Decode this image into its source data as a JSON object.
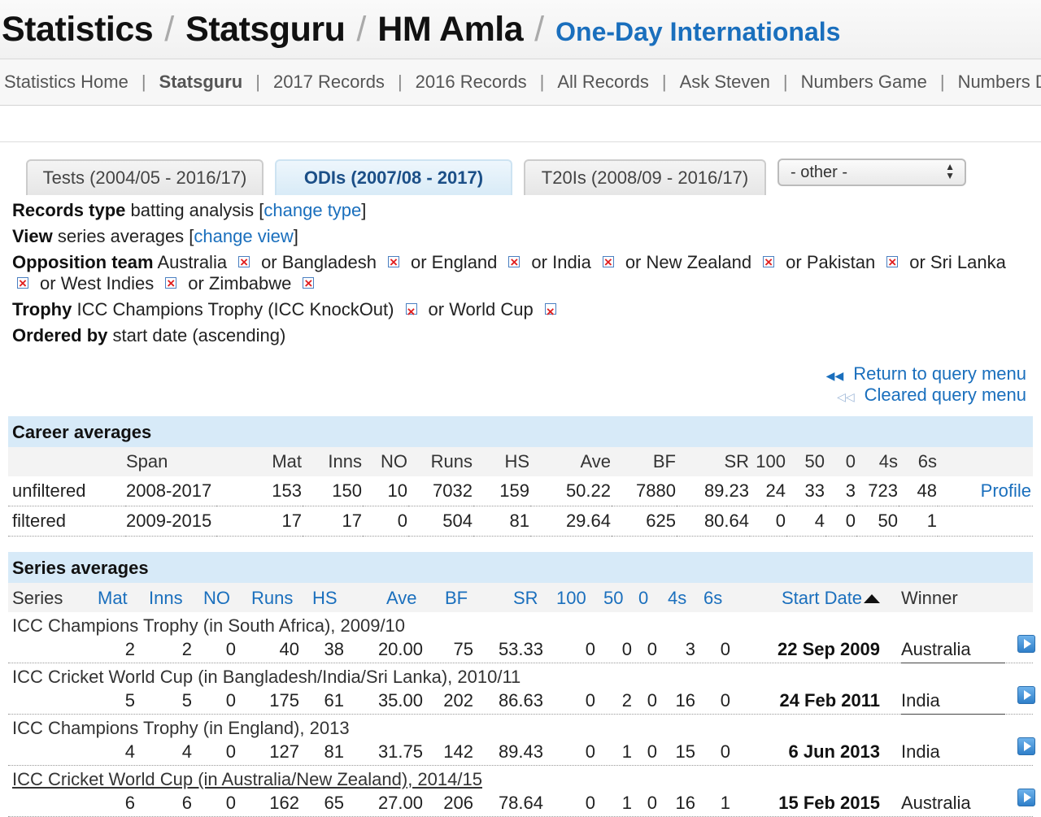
{
  "breadcrumb": {
    "items": [
      "Statistics",
      "Statsguru",
      "HM Amla"
    ],
    "separator": "/",
    "current": "One-Day Internationals"
  },
  "nav": {
    "items": [
      {
        "label": "Statistics Home",
        "active": false
      },
      {
        "label": "Statsguru",
        "active": true
      },
      {
        "label": "2017 Records",
        "active": false
      },
      {
        "label": "2016 Records",
        "active": false
      },
      {
        "label": "All Records",
        "active": false
      },
      {
        "label": "Ask Steven",
        "active": false
      },
      {
        "label": "Numbers Game",
        "active": false
      },
      {
        "label": "Numbers Don't",
        "active": false
      }
    ],
    "separator": "|"
  },
  "tabs": [
    {
      "label": "Tests (2004/05 - 2016/17)",
      "active": false
    },
    {
      "label": "ODIs (2007/08 - 2017)",
      "active": true
    },
    {
      "label": "T20Is (2008/09 - 2016/17)",
      "active": false
    }
  ],
  "other_select": {
    "value": "- other -"
  },
  "criteria": {
    "records_type": {
      "label": "Records type",
      "value": "batting analysis",
      "link": "change type"
    },
    "view": {
      "label": "View",
      "value": "series averages",
      "link": "change view"
    },
    "opposition": {
      "label": "Opposition team",
      "teams": [
        "Australia",
        "Bangladesh",
        "England",
        "India",
        "New Zealand",
        "Pakistan",
        "Sri Lanka",
        "West Indies",
        "Zimbabwe"
      ],
      "joiner": "or"
    },
    "trophy": {
      "label": "Trophy",
      "items": [
        "ICC Champions Trophy (ICC KnockOut)",
        "World Cup"
      ]
    },
    "ordered": {
      "label": "Ordered by",
      "value": "start date (ascending)"
    }
  },
  "query_links": {
    "return": "Return to query menu",
    "cleared": "Cleared query menu"
  },
  "career": {
    "title": "Career averages",
    "columns": [
      "Span",
      "Mat",
      "Inns",
      "NO",
      "Runs",
      "HS",
      "Ave",
      "BF",
      "SR",
      "100",
      "50",
      "0",
      "4s",
      "6s"
    ],
    "rows": [
      {
        "label": "unfiltered",
        "cells": [
          "2008-2017",
          "153",
          "150",
          "10",
          "7032",
          "159",
          "50.22",
          "7880",
          "89.23",
          "24",
          "33",
          "3",
          "723",
          "48"
        ],
        "link": "Profile"
      },
      {
        "label": "filtered",
        "cells": [
          "2009-2015",
          "17",
          "17",
          "0",
          "504",
          "81",
          "29.64",
          "625",
          "80.64",
          "0",
          "4",
          "0",
          "50",
          "1"
        ],
        "link": ""
      }
    ]
  },
  "series": {
    "title": "Series averages",
    "columns": [
      "Series",
      "Mat",
      "Inns",
      "NO",
      "Runs",
      "HS",
      "Ave",
      "BF",
      "SR",
      "100",
      "50",
      "0",
      "4s",
      "6s",
      "Start Date",
      "Winner"
    ],
    "rows": [
      {
        "name": "ICC Champions Trophy (in South Africa), 2009/10",
        "cells": [
          "2",
          "2",
          "0",
          "40",
          "38",
          "20.00",
          "75",
          "53.33",
          "0",
          "0",
          "0",
          "3",
          "0"
        ],
        "date": "22 Sep 2009",
        "winner": "Australia"
      },
      {
        "name": "ICC Cricket World Cup (in Bangladesh/India/Sri Lanka), 2010/11",
        "cells": [
          "5",
          "5",
          "0",
          "175",
          "61",
          "35.00",
          "202",
          "86.63",
          "0",
          "2",
          "0",
          "16",
          "0"
        ],
        "date": "24 Feb 2011",
        "winner": "India"
      },
      {
        "name": "ICC Champions Trophy (in England), 2013",
        "cells": [
          "4",
          "4",
          "0",
          "127",
          "81",
          "31.75",
          "142",
          "89.43",
          "0",
          "1",
          "0",
          "15",
          "0"
        ],
        "date": "6 Jun 2013",
        "winner": "India"
      },
      {
        "name": "ICC Cricket World Cup (in Australia/New Zealand), 2014/15",
        "cells": [
          "6",
          "6",
          "0",
          "162",
          "65",
          "27.00",
          "206",
          "78.64",
          "0",
          "1",
          "0",
          "16",
          "1"
        ],
        "date": "15 Feb 2015",
        "winner": "Australia"
      }
    ]
  }
}
